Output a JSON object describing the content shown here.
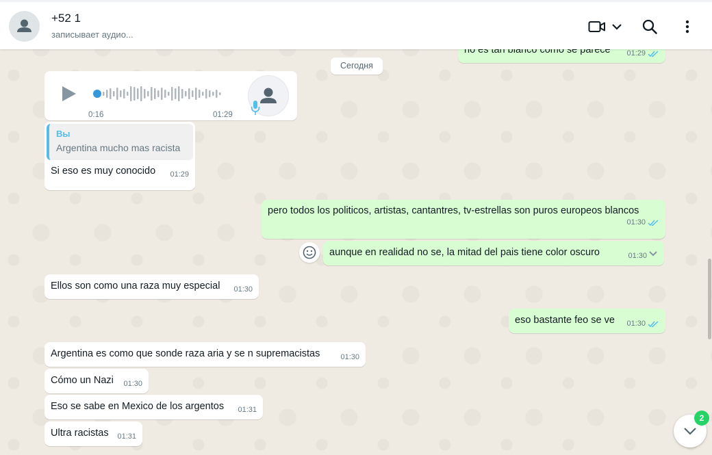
{
  "header": {
    "contact_name": "+52 1",
    "contact_status": "записывает аудио..."
  },
  "date_separator": "Сегодня",
  "audio_message": {
    "duration": "0:16",
    "time": "01:29"
  },
  "messages": [
    {
      "dir": "out",
      "text": "no es tan blanco como se parece",
      "time": "01:29",
      "ticks": "read"
    },
    {
      "dir": "in",
      "text": "Si eso es muy conocido",
      "time": "01:29",
      "quote_author": "Вы",
      "quote_text": "Argentina mucho mas racista"
    },
    {
      "dir": "out",
      "text": "pero todos los politicos, artistas, cantantres, tv-estrellas son puros europeos blancos",
      "time": "01:30",
      "ticks": "read"
    },
    {
      "dir": "out",
      "text": "aunque en realidad no se, la mitad del pais tiene color oscuro",
      "time": "01:30",
      "ticks": "read"
    },
    {
      "dir": "in",
      "text": "Ellos son como una raza muy especial",
      "time": "01:30"
    },
    {
      "dir": "out",
      "text": "eso bastante feo se ve",
      "time": "01:30",
      "ticks": "read"
    },
    {
      "dir": "in",
      "text": "Argentina es como que sonde raza aria y se n supremacistas",
      "time": "01:30"
    },
    {
      "dir": "in",
      "text": "Cómo un Nazi",
      "time": "01:30"
    },
    {
      "dir": "in",
      "text": "Eso se sabe en Mexico de los argentos",
      "time": "01:31"
    },
    {
      "dir": "in",
      "text": "Ultra racistas",
      "time": "01:31"
    }
  ],
  "unread_badge": "2",
  "colors": {
    "incoming": "#ffffff",
    "outgoing": "#d9fdd3",
    "read_ticks": "#53bdeb",
    "accent": "#25d366"
  },
  "icons": [
    "avatar-icon",
    "video-call-icon",
    "chevron-down-icon",
    "search-icon",
    "menu-icon",
    "play-icon",
    "mic-icon",
    "emoji-icon",
    "scroll-down-icon"
  ]
}
